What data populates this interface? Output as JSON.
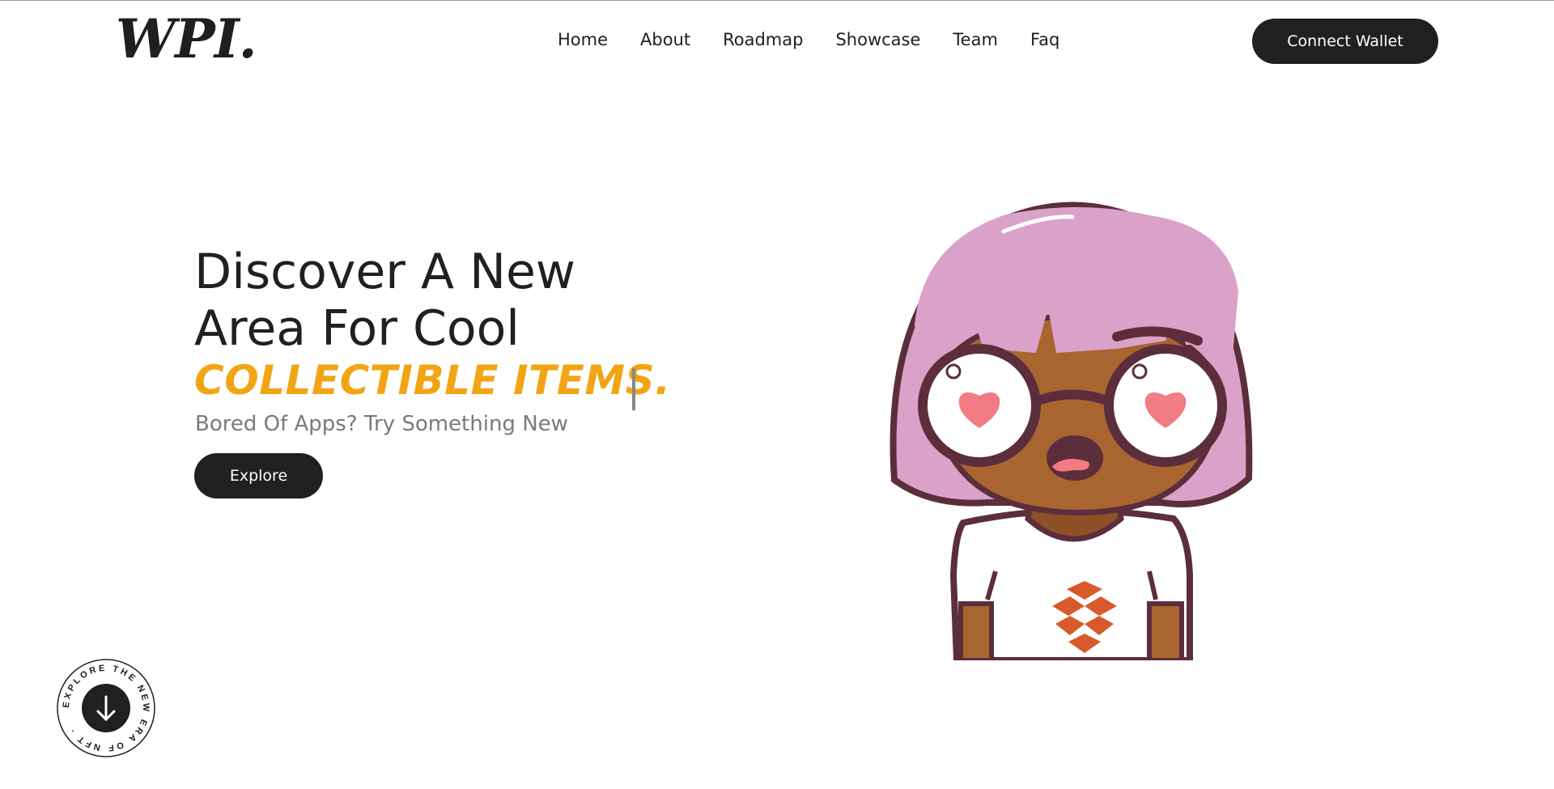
{
  "brand": {
    "logo": "WPI."
  },
  "nav": {
    "items": [
      "Home",
      "About",
      "Roadmap",
      "Showcase",
      "Team",
      "Faq"
    ]
  },
  "header": {
    "connect_label": "Connect Wallet"
  },
  "hero": {
    "title_line1": "Discover A New",
    "title_line2": "Area For Cool",
    "accent": "COLLECTIBLE ITEMS.",
    "subtitle": "Bored Of Apps? Try Something New",
    "explore_label": "Explore"
  },
  "badge": {
    "circle_text": "EXPLORE THE NEW ERA OF NFT ·",
    "icon": "arrow-down-icon"
  },
  "colors": {
    "accent": "#f2a514",
    "dark": "#202020",
    "hair": "#dba2c9",
    "skin": "#a8652f"
  },
  "illustration": {
    "icon": "nft-character-illustration"
  }
}
